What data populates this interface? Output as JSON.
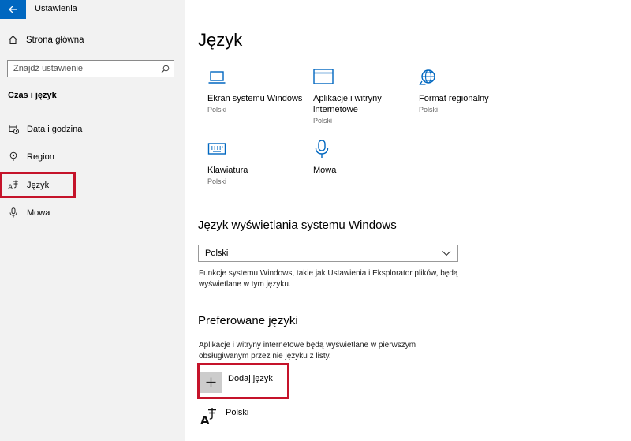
{
  "window": {
    "title": "Ustawienia"
  },
  "sidebar": {
    "home": "Strona główna",
    "search_placeholder": "Znajdź ustawienie",
    "section": "Czas i język",
    "items": [
      {
        "label": "Data i godzina",
        "icon": "calendar-clock-icon"
      },
      {
        "label": "Region",
        "icon": "region-icon"
      },
      {
        "label": "Język",
        "icon": "language-icon"
      },
      {
        "label": "Mowa",
        "icon": "microphone-icon"
      }
    ]
  },
  "main": {
    "title": "Język",
    "tiles": [
      {
        "name": "Ekran systemu Windows",
        "sub": "Polski",
        "icon": "laptop-icon"
      },
      {
        "name": "Aplikacje i witryny internetowe",
        "sub": "Polski",
        "icon": "window-icon"
      },
      {
        "name": "Format regionalny",
        "sub": "Polski",
        "icon": "globe-icon"
      },
      {
        "name": "Klawiatura",
        "sub": "Polski",
        "icon": "keyboard-icon"
      },
      {
        "name": "Mowa",
        "sub": "",
        "icon": "microphone-icon"
      }
    ],
    "display_lang": {
      "heading": "Język wyświetlania systemu Windows",
      "selected": "Polski",
      "description": "Funkcje systemu Windows, takie jak Ustawienia i Eksplorator plików, będą wyświetlane w tym języku."
    },
    "preferred": {
      "heading": "Preferowane języki",
      "description": "Aplikacje i witryny internetowe będą wyświetlane w pierwszym obsługiwanym przez nie języku z listy.",
      "add_label": "Dodaj język",
      "languages": [
        {
          "label": "Polski"
        }
      ]
    }
  },
  "colors": {
    "accent": "#0067c0",
    "highlight": "#c5132a"
  }
}
